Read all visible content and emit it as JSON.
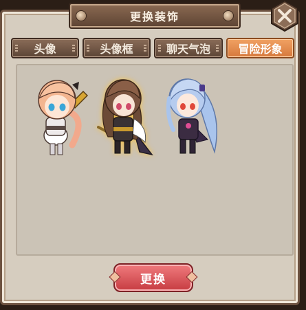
{
  "dialog": {
    "title": "更换装饰",
    "tabs": [
      {
        "label": "头像",
        "active": false
      },
      {
        "label": "头像框",
        "active": false
      },
      {
        "label": "聊天气泡",
        "active": false
      },
      {
        "label": "冒险形象",
        "active": true
      }
    ],
    "characters": [
      {
        "icon": "blonde-girl-with-sword-avatar",
        "selected": false
      },
      {
        "icon": "brown-haired-swordswoman-avatar",
        "selected": true
      },
      {
        "icon": "blue-ponytail-girl-avatar",
        "selected": false
      }
    ],
    "confirm_label": "更换"
  }
}
